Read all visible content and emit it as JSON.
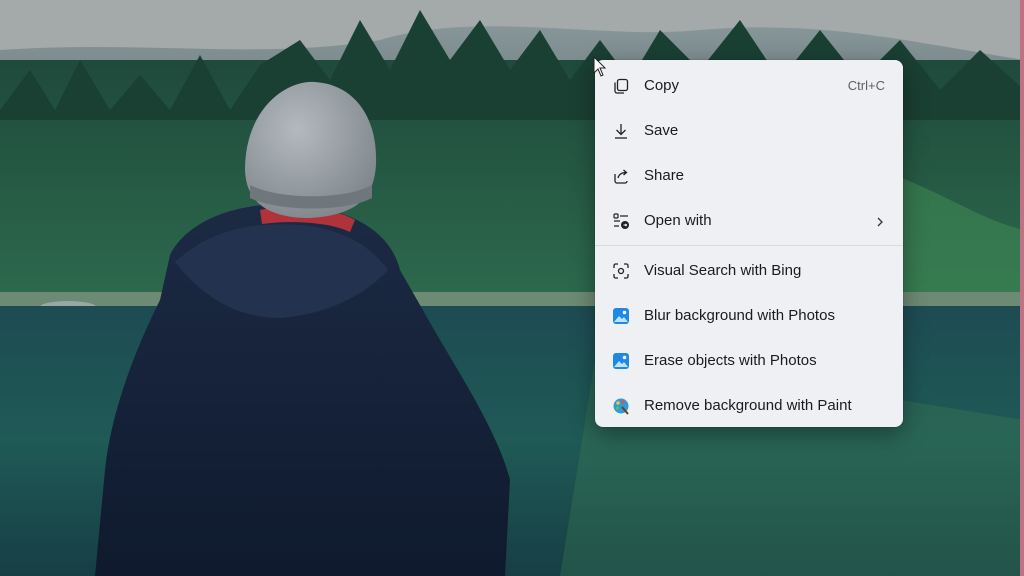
{
  "context_menu": {
    "items": [
      {
        "label": "Copy",
        "icon": "copy-icon",
        "shortcut": "Ctrl+C"
      },
      {
        "label": "Save",
        "icon": "download-icon"
      },
      {
        "label": "Share",
        "icon": "share-icon"
      },
      {
        "label": "Open with",
        "icon": "open-with-icon",
        "submenu": true
      },
      {
        "label": "Visual Search with Bing",
        "icon": "visual-search-icon"
      },
      {
        "label": "Blur background with Photos",
        "icon": "photos-app-icon"
      },
      {
        "label": "Erase objects with Photos",
        "icon": "photos-app-icon"
      },
      {
        "label": "Remove background with Paint",
        "icon": "paint-app-icon"
      }
    ]
  },
  "colors": {
    "menu_bg": "#eef0f3",
    "photos_icon": "#1e88e5",
    "edge_accent": "#c27185"
  }
}
